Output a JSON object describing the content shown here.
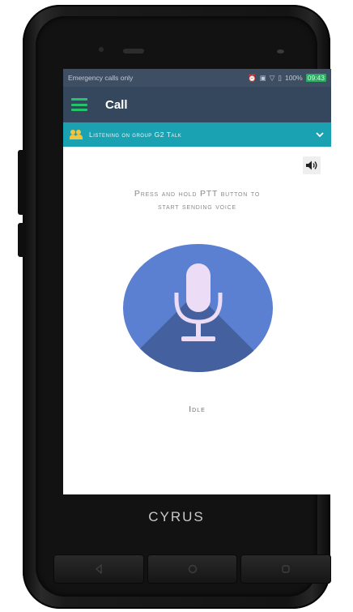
{
  "status_bar": {
    "carrier_text": "Emergency calls only",
    "right_text": "100%",
    "time": "09:43",
    "icons": [
      "alarm-icon",
      "nfc-icon",
      "wifi-icon",
      "battery-icon"
    ]
  },
  "app_bar": {
    "title": "Call",
    "menu_icon": "hamburger-menu-icon"
  },
  "group_bar": {
    "text": "Listening on group G2 Talk",
    "icon": "group-icon",
    "expand_icon": "chevron-down-icon"
  },
  "main": {
    "volume_icon": "speaker-volume-icon",
    "instruction_line1": "Press and hold PTT button to",
    "instruction_line2": "start sending voice",
    "ptt_icon": "microphone-icon",
    "state": "Idle"
  },
  "device": {
    "brand": "CYRUS"
  },
  "nav": {
    "back_icon": "back-icon",
    "home_icon": "home-icon",
    "recents_icon": "recents-icon"
  },
  "colors": {
    "status_bar": "#3e4e63",
    "app_bar": "#34475c",
    "group_bar": "#1aa2b3",
    "ptt_button": "#5b7fd1",
    "menu_accent": "#25c46b"
  }
}
